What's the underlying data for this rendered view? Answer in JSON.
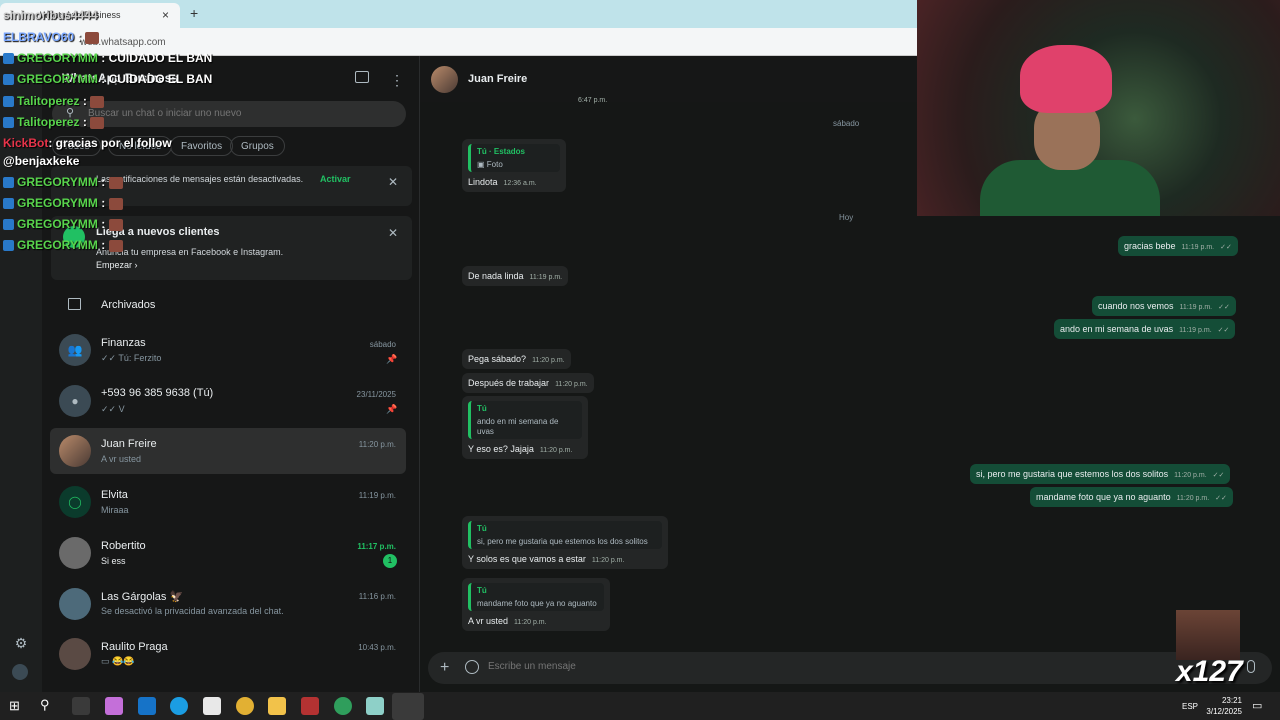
{
  "browser": {
    "tab_title": "WhatsApp Business",
    "close": "×",
    "new_tab": "+",
    "url": "web.whatsapp.com"
  },
  "app": {
    "title": "WhatsApp Business"
  },
  "search": {
    "placeholder": "Buscar un chat o iniciar uno nuevo"
  },
  "filters": [
    "Todos",
    "No leídos",
    "Favoritos",
    "Grupos"
  ],
  "notifications": {
    "text": "Las notificaciones de mensajes están desactivadas.",
    "action": "Activar"
  },
  "promo": {
    "title": "Llega a nuevos clientes",
    "subtitle": "Anuncia tu empresa en Facebook e Instagram.",
    "action": "Empezar"
  },
  "archived": "Archivados",
  "chats": [
    {
      "name": "Finanzas",
      "preview": "Tú: Ferzito",
      "time": "sábado",
      "pinned": true
    },
    {
      "name": "+593 96 385 9638 (Tú)",
      "preview": "V",
      "time": "23/11/2025",
      "pinned": true
    },
    {
      "name": "Juan Freire",
      "preview": "A vr usted",
      "time": "11:20 p.m.",
      "selected": true
    },
    {
      "name": "Elvita",
      "preview": "Miraaa",
      "time": "11:19 p.m."
    },
    {
      "name": "Robertito",
      "preview": "Si ess",
      "time": "11:17 p.m.",
      "unread": "1"
    },
    {
      "name": "Las Gárgolas 🦅",
      "preview": "Se desactivó la privacidad avanzada del chat.",
      "time": "11:16 p.m."
    },
    {
      "name": "Raulito Praga",
      "preview": "😂😂",
      "time": "10:43 p.m."
    }
  ],
  "conversation": {
    "contact": "Juan Freire",
    "date_sabado": "sábado",
    "date_hoy": "Hoy",
    "top_time": "6:47 p.m.",
    "status_reply": {
      "author": "Tú · Estados",
      "media": "Foto",
      "text": "Lindota",
      "time": "12:36 a.m."
    },
    "messages": [
      {
        "dir": "out",
        "text": "gracias bebe",
        "time": "11:19 p.m."
      },
      {
        "dir": "in",
        "text": "De nada linda",
        "time": "11:19 p.m."
      },
      {
        "dir": "out",
        "text": "cuando nos vemos",
        "time": "11:19 p.m."
      },
      {
        "dir": "out",
        "text": "ando en mi semana de uvas",
        "time": "11:19 p.m."
      },
      {
        "dir": "in",
        "text": "Pega sábado?",
        "time": "11:20 p.m."
      },
      {
        "dir": "in",
        "text": "Después de trabajar",
        "time": "11:20 p.m."
      },
      {
        "dir": "in",
        "quote_author": "Tú",
        "quote": "ando en mi semana de uvas",
        "text": "Y eso es? Jajaja",
        "time": "11:20 p.m."
      },
      {
        "dir": "out",
        "text": "si, pero me gustaria que estemos los dos solitos",
        "time": "11:20 p.m."
      },
      {
        "dir": "out",
        "text": "mandame foto que ya no aguanto",
        "time": "11:20 p.m."
      },
      {
        "dir": "in",
        "quote_author": "Tú",
        "quote": "si, pero me gustaria que estemos los dos solitos",
        "text": "Y solos es que vamos a estar",
        "time": "11:20 p.m."
      },
      {
        "dir": "in",
        "quote_author": "Tú",
        "quote": "mandame foto que ya no aguanto",
        "text": "A vr usted",
        "time": "11:20 p.m."
      }
    ],
    "composer_placeholder": "Escribe un mensaje"
  },
  "stream_chat": [
    {
      "user": "sinimoribus4444",
      "msg": ""
    },
    {
      "user": "ELBRAVO60",
      "msg": ":"
    },
    {
      "user": "GREGORYMM",
      "msg": ": CUIDADO EL BAN"
    },
    {
      "user": "GREGORYMM",
      "msg": ": CUIDADO EL BAN"
    },
    {
      "user": "Talitoperez",
      "msg": ":"
    },
    {
      "user": "Talitoperez",
      "msg": ":"
    },
    {
      "user": "KickBot",
      "msg": ": gracias por el follow"
    },
    {
      "user": "@benjaxkeke",
      "msg": ""
    },
    {
      "user": "GREGORYMM",
      "msg": ":"
    },
    {
      "user": "GREGORYMM",
      "msg": ":"
    },
    {
      "user": "GREGORYMM",
      "msg": ":"
    },
    {
      "user": "GREGORYMM",
      "msg": ":"
    }
  ],
  "emote_count": "x127",
  "taskbar": {
    "lang": "ESP",
    "time": "23:21",
    "date": "3/12/2025"
  },
  "colors": {
    "accent": "#21c063",
    "bubble_out": "#144d37",
    "bubble_in": "#242626",
    "bg": "#161717"
  }
}
